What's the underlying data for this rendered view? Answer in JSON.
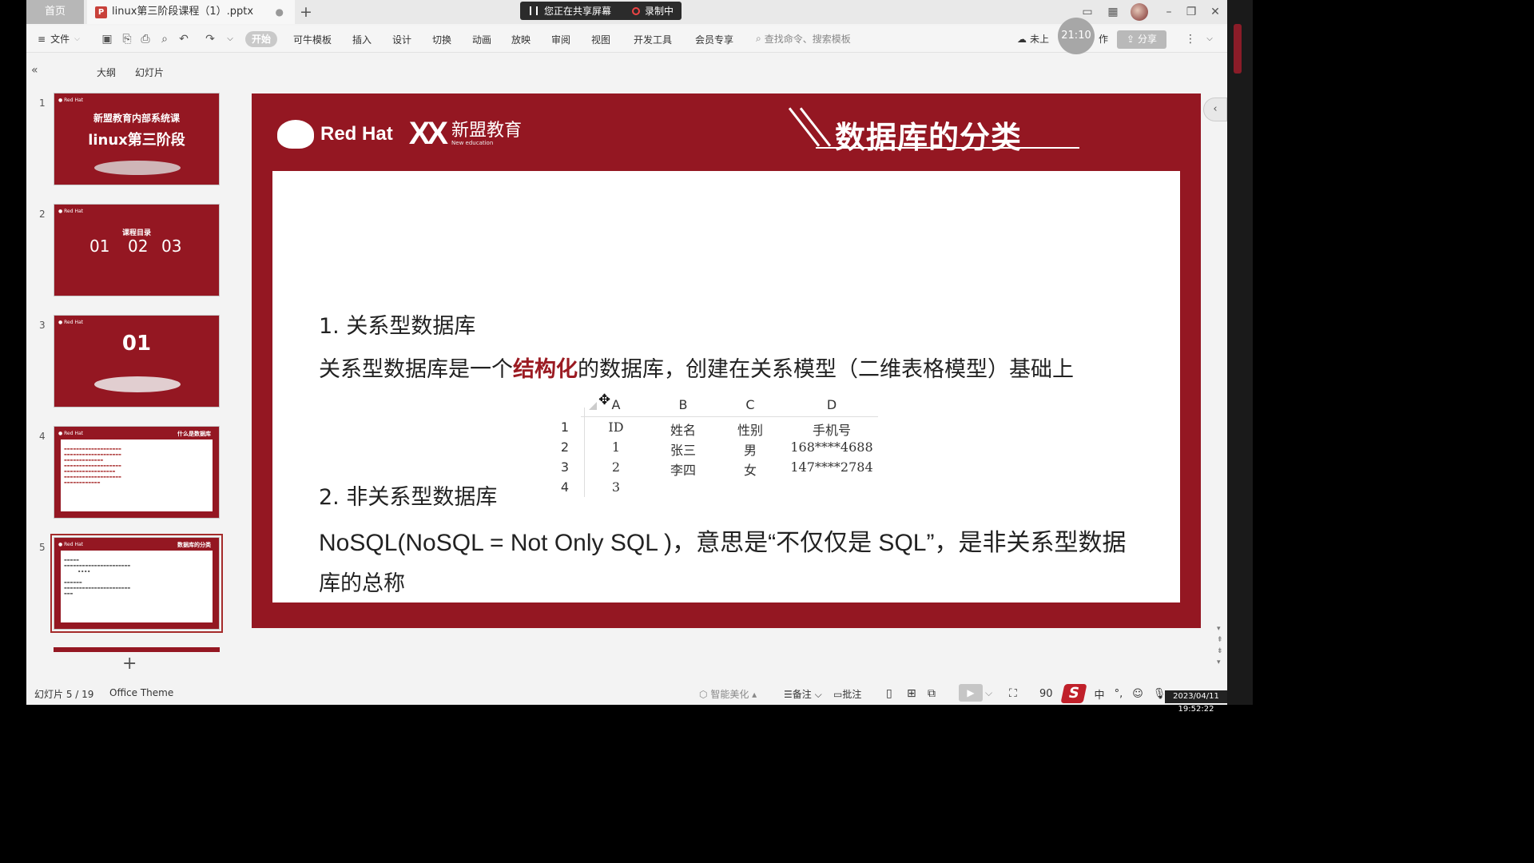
{
  "titlebar": {
    "home_tab": "首页",
    "doc_tab": "linux第三阶段课程（1）.pptx",
    "doc_icon": "P",
    "unsaved_dot": "●",
    "add_tab": "+",
    "sharing_text": "您正在共享屏幕",
    "recording_text": "录制中"
  },
  "ribbon": {
    "file_menu": "文件",
    "tabs": [
      "开始",
      "可牛模板",
      "插入",
      "设计",
      "切换",
      "动画",
      "放映",
      "审阅",
      "视图",
      "开发工具",
      "会员专享"
    ],
    "search_placeholder": "查找命令、搜索模板",
    "cloud_text": "未上",
    "clock": "21:10",
    "cowork": "作",
    "share_button": "分享"
  },
  "left_panel": {
    "sub_tabs": [
      "大纲",
      "幻灯片"
    ],
    "thumbs": [
      {
        "num": "1",
        "title_line1": "新盟教育内部系统课",
        "title_line2": "linux第三阶段"
      },
      {
        "num": "2",
        "title": "课程目录",
        "items": [
          "01",
          "02",
          "03"
        ]
      },
      {
        "num": "3",
        "title": "01"
      },
      {
        "num": "4",
        "head": "什么是数据库"
      },
      {
        "num": "5",
        "head": "数据库的分类"
      }
    ]
  },
  "slide": {
    "logo_text": "Red Hat",
    "partner_mark": "XX",
    "partner_name": "新盟教育",
    "partner_sub": "New education",
    "title": "数据库的分类",
    "heading1": "1. 关系型数据库",
    "line1_before": "关系型数据库是一个",
    "line1_highlight": "结构化",
    "line1_after": "的数据库，创建在关系模型（二维表格模型）基础上",
    "table": {
      "col_letters": [
        "A",
        "B",
        "C",
        "D"
      ],
      "row_numbers": [
        "1",
        "2",
        "3",
        "4"
      ],
      "rows": [
        [
          "ID",
          "姓名",
          "性别",
          "手机号"
        ],
        [
          "1",
          "张三",
          "男",
          "168****4688"
        ],
        [
          "2",
          "李四",
          "女",
          "147****2784"
        ],
        [
          "3",
          "",
          "",
          ""
        ]
      ]
    },
    "heading2": "2. 非关系型数据库",
    "line2": "NoSQL(NoSQL = Not Only SQL )，意思是“不仅仅是 SQL”，是非关系型数据",
    "line3": "库的总称"
  },
  "statusbar": {
    "slide_counter": "幻灯片 5 / 19",
    "theme": "Office Theme",
    "beautify": "智能美化",
    "notes": "备注",
    "comments": "批注",
    "zoom": "90",
    "ime": "中",
    "datetime": "2023/04/11 19:52:22"
  },
  "colors": {
    "slide_red": "#941722",
    "highlight_red": "#9b1b22"
  }
}
